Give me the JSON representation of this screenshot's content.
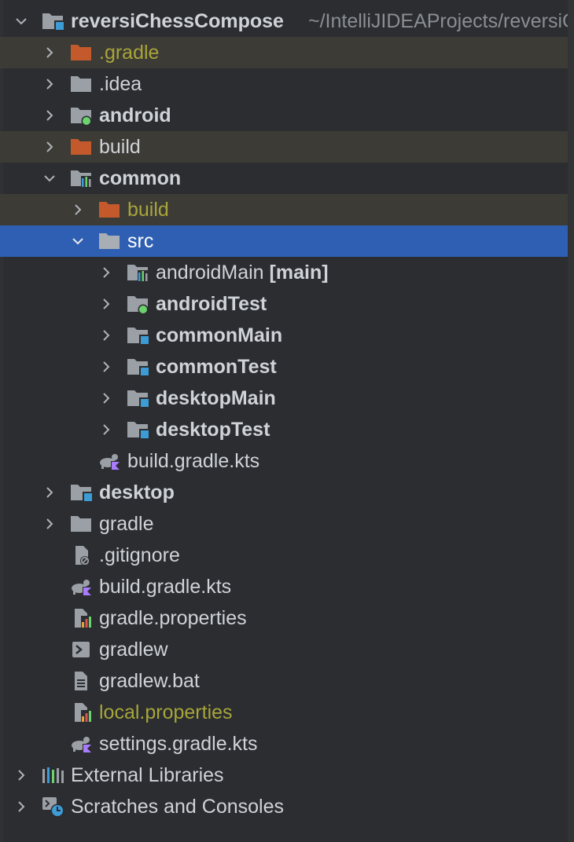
{
  "tree": {
    "root": {
      "name": "reversiChessCompose",
      "path": "~/IntelliJIDEAProjects/reversiChessCompose"
    },
    "gradle_dir": {
      "name": ".gradle"
    },
    "idea_dir": {
      "name": ".idea"
    },
    "android_module": {
      "name": "android"
    },
    "build_dir": {
      "name": "build"
    },
    "common_module": {
      "name": "common"
    },
    "common_build": {
      "name": "build"
    },
    "common_src": {
      "name": "src"
    },
    "source_sets": [
      {
        "name": "androidMain",
        "suffix": " [main]"
      },
      {
        "name": "androidTest"
      },
      {
        "name": "commonMain"
      },
      {
        "name": "commonTest"
      },
      {
        "name": "desktopMain"
      },
      {
        "name": "desktopTest"
      }
    ],
    "common_build_script": {
      "name": "build.gradle.kts"
    },
    "desktop_module": {
      "name": "desktop"
    },
    "gradle_wrapper_dir": {
      "name": "gradle"
    },
    "files": [
      {
        "name": ".gitignore",
        "icon": "gitignore-file-icon"
      },
      {
        "name": "build.gradle.kts",
        "icon": "gradle-kotlin-script-icon"
      },
      {
        "name": "gradle.properties",
        "icon": "properties-file-icon"
      },
      {
        "name": "gradlew",
        "icon": "shell-script-icon"
      },
      {
        "name": "gradlew.bat",
        "icon": "text-file-icon"
      },
      {
        "name": "local.properties",
        "icon": "properties-file-icon"
      },
      {
        "name": "settings.gradle.kts",
        "icon": "gradle-kotlin-script-icon"
      }
    ],
    "external_libraries": {
      "name": "External Libraries"
    },
    "scratches": {
      "name": "Scratches and Consoles"
    }
  },
  "colors": {
    "background": "#2b2d30",
    "selection": "#2f5fb3",
    "ignored_row": "#3d3b36",
    "excluded_folder": "#c45a2c",
    "folder": "#9aa0a6",
    "module_badge": "#3d9bd6",
    "android_badge": "#6bd36b",
    "ignored_text": "#a8a53a",
    "kotlin_badge": "#a97bff"
  }
}
